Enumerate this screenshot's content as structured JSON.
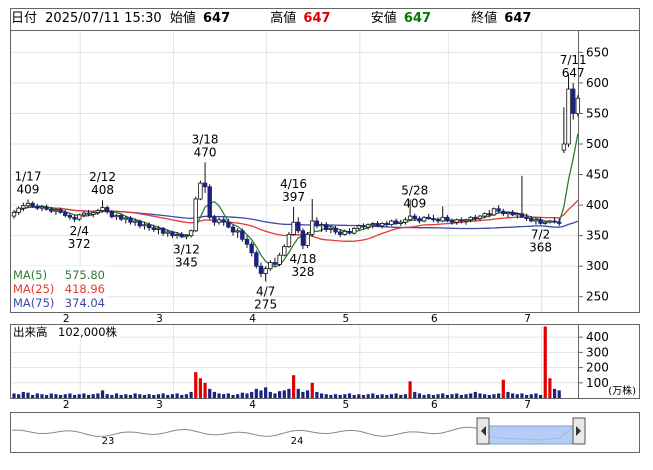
{
  "header": {
    "date_label": "日付",
    "date_value": "2025/07/11 15:30",
    "open_label": "始値",
    "open_value": "647",
    "high_label": "高値",
    "high_value": "647",
    "low_label": "安値",
    "low_value": "647",
    "close_label": "終値",
    "close_value": "647"
  },
  "colors": {
    "candle_up": "#ffffff",
    "candle_down": "#1a237e",
    "ma5": "#2e7d32",
    "ma25": "#e53935",
    "ma75": "#3949ab",
    "volume_normal": "#1a237e",
    "volume_high": "#e00000",
    "navigator_fill": "#a8c4f0"
  },
  "chart_data": [
    {
      "type": "candlestick",
      "ylim": [
        225,
        685
      ],
      "y_ticks": [
        250,
        300,
        350,
        400,
        450,
        500,
        550,
        600,
        650
      ],
      "x_tick_labels": [
        "2",
        "3",
        "4",
        "5",
        "6",
        "7"
      ],
      "x_tick_index": [
        14,
        34,
        54,
        74,
        93,
        113
      ],
      "moving_averages": [
        {
          "label": "MA(5)",
          "value": "575.80",
          "color": "#2e7d32"
        },
        {
          "label": "MA(25)",
          "value": "418.96",
          "color": "#e53935"
        },
        {
          "label": "MA(75)",
          "value": "374.04",
          "color": "#3949ab"
        }
      ],
      "annotations": [
        {
          "date": "1/17",
          "value": "409",
          "index": 3
        },
        {
          "date": "2/12",
          "value": "408",
          "index": 19
        },
        {
          "date": "2/4",
          "value": "372",
          "index": 14
        },
        {
          "date": "3/18",
          "value": "470",
          "index": 41
        },
        {
          "date": "3/12",
          "value": "345",
          "index": 37
        },
        {
          "date": "4/16",
          "value": "397",
          "index": 60
        },
        {
          "date": "4/18",
          "value": "328",
          "index": 62
        },
        {
          "date": "4/7",
          "value": "275",
          "index": 54
        },
        {
          "date": "5/28",
          "value": "409",
          "index": 86
        },
        {
          "date": "7/2",
          "value": "368",
          "index": 113
        },
        {
          "date": "7/11",
          "value": "647",
          "index": 120
        }
      ],
      "ohlc": [
        [
          382,
          392,
          378,
          388
        ],
        [
          388,
          398,
          384,
          395
        ],
        [
          395,
          404,
          390,
          399
        ],
        [
          399,
          409,
          395,
          403
        ],
        [
          403,
          406,
          396,
          398
        ],
        [
          398,
          402,
          392,
          395
        ],
        [
          395,
          400,
          390,
          397
        ],
        [
          397,
          401,
          391,
          393
        ],
        [
          393,
          397,
          387,
          390
        ],
        [
          390,
          394,
          384,
          392
        ],
        [
          392,
          396,
          386,
          388
        ],
        [
          388,
          392,
          380,
          383
        ],
        [
          383,
          387,
          376,
          380
        ],
        [
          380,
          384,
          372,
          377
        ],
        [
          377,
          386,
          374,
          384
        ],
        [
          384,
          390,
          380,
          387
        ],
        [
          387,
          392,
          382,
          385
        ],
        [
          385,
          390,
          380,
          388
        ],
        [
          388,
          394,
          384,
          391
        ],
        [
          391,
          408,
          388,
          396
        ],
        [
          396,
          399,
          386,
          389
        ],
        [
          389,
          392,
          378,
          381
        ],
        [
          381,
          386,
          376,
          383
        ],
        [
          383,
          386,
          374,
          377
        ],
        [
          377,
          382,
          370,
          379
        ],
        [
          379,
          382,
          368,
          372
        ],
        [
          372,
          378,
          366,
          374
        ],
        [
          374,
          376,
          362,
          366
        ],
        [
          366,
          372,
          360,
          368
        ],
        [
          368,
          372,
          358,
          363
        ],
        [
          363,
          368,
          356,
          360
        ],
        [
          360,
          366,
          352,
          362
        ],
        [
          362,
          364,
          350,
          354
        ],
        [
          354,
          360,
          348,
          356
        ],
        [
          356,
          358,
          346,
          350
        ],
        [
          350,
          356,
          345,
          352
        ],
        [
          352,
          356,
          346,
          348
        ],
        [
          348,
          352,
          344,
          350
        ],
        [
          350,
          360,
          347,
          358
        ],
        [
          358,
          414,
          356,
          410
        ],
        [
          410,
          440,
          408,
          436
        ],
        [
          436,
          470,
          420,
          430
        ],
        [
          430,
          434,
          376,
          380
        ],
        [
          380,
          384,
          366,
          372
        ],
        [
          372,
          380,
          368,
          376
        ],
        [
          376,
          380,
          366,
          372
        ],
        [
          372,
          378,
          362,
          364
        ],
        [
          364,
          368,
          350,
          356
        ],
        [
          356,
          362,
          346,
          358
        ],
        [
          358,
          362,
          340,
          344
        ],
        [
          344,
          350,
          330,
          336
        ],
        [
          336,
          340,
          316,
          322
        ],
        [
          322,
          326,
          296,
          300
        ],
        [
          300,
          306,
          282,
          288
        ],
        [
          288,
          300,
          275,
          296
        ],
        [
          296,
          310,
          292,
          306
        ],
        [
          306,
          314,
          300,
          303
        ],
        [
          303,
          322,
          300,
          318
        ],
        [
          318,
          336,
          316,
          332
        ],
        [
          332,
          356,
          330,
          352
        ],
        [
          352,
          397,
          350,
          372
        ],
        [
          372,
          380,
          354,
          358
        ],
        [
          358,
          362,
          328,
          334
        ],
        [
          334,
          356,
          330,
          352
        ],
        [
          352,
          410,
          348,
          374
        ],
        [
          374,
          380,
          362,
          366
        ],
        [
          366,
          372,
          356,
          368
        ],
        [
          368,
          372,
          356,
          360
        ],
        [
          360,
          366,
          354,
          362
        ],
        [
          362,
          366,
          352,
          356
        ],
        [
          356,
          360,
          348,
          352
        ],
        [
          352,
          360,
          350,
          357
        ],
        [
          357,
          362,
          352,
          354
        ],
        [
          354,
          364,
          352,
          362
        ],
        [
          362,
          368,
          358,
          366
        ],
        [
          366,
          370,
          360,
          364
        ],
        [
          364,
          370,
          360,
          368
        ],
        [
          368,
          372,
          362,
          370
        ],
        [
          370,
          374,
          364,
          366
        ],
        [
          366,
          372,
          362,
          370
        ],
        [
          370,
          374,
          364,
          368
        ],
        [
          368,
          376,
          366,
          374
        ],
        [
          374,
          378,
          368,
          370
        ],
        [
          370,
          376,
          366,
          372
        ],
        [
          372,
          380,
          368,
          376
        ],
        [
          376,
          409,
          374,
          382
        ],
        [
          382,
          386,
          374,
          378
        ],
        [
          378,
          382,
          370,
          374
        ],
        [
          374,
          382,
          372,
          380
        ],
        [
          380,
          386,
          376,
          378
        ],
        [
          378,
          384,
          372,
          376
        ],
        [
          376,
          380,
          370,
          374
        ],
        [
          374,
          398,
          372,
          380
        ],
        [
          380,
          384,
          372,
          374
        ],
        [
          374,
          378,
          368,
          372
        ],
        [
          372,
          378,
          368,
          376
        ],
        [
          376,
          380,
          370,
          374
        ],
        [
          374,
          378,
          368,
          376
        ],
        [
          376,
          382,
          372,
          380
        ],
        [
          380,
          384,
          374,
          378
        ],
        [
          378,
          384,
          374,
          382
        ],
        [
          382,
          388,
          378,
          386
        ],
        [
          386,
          392,
          380,
          384
        ],
        [
          384,
          396,
          382,
          394
        ],
        [
          394,
          400,
          386,
          390
        ],
        [
          390,
          394,
          382,
          386
        ],
        [
          386,
          390,
          380,
          388
        ],
        [
          388,
          392,
          382,
          384
        ],
        [
          384,
          388,
          378,
          386
        ],
        [
          386,
          448,
          382,
          380
        ],
        [
          380,
          386,
          374,
          378
        ],
        [
          378,
          382,
          372,
          374
        ],
        [
          374,
          378,
          368,
          376
        ],
        [
          376,
          380,
          368,
          370
        ],
        [
          370,
          374,
          368,
          372
        ],
        [
          372,
          376,
          370,
          374
        ],
        [
          374,
          380,
          370,
          372
        ],
        [
          372,
          378,
          366,
          370
        ],
        [
          490,
          560,
          485,
          500
        ],
        [
          500,
          615,
          495,
          590
        ],
        [
          590,
          600,
          540,
          550
        ],
        [
          550,
          580,
          545,
          575
        ]
      ]
    },
    {
      "type": "bar",
      "title": "出来高",
      "value_label": "102,000株",
      "unit_label": "(万株)",
      "y_ticks": [
        100,
        200,
        300,
        400
      ],
      "ylim": [
        0,
        480
      ],
      "values": [
        30,
        25,
        40,
        35,
        20,
        30,
        25,
        20,
        30,
        25,
        20,
        25,
        30,
        20,
        25,
        30,
        20,
        25,
        30,
        50,
        25,
        20,
        30,
        20,
        25,
        20,
        30,
        25,
        20,
        25,
        20,
        25,
        30,
        20,
        25,
        30,
        20,
        25,
        40,
        170,
        130,
        100,
        60,
        40,
        30,
        25,
        30,
        20,
        25,
        35,
        30,
        40,
        60,
        50,
        70,
        40,
        30,
        45,
        50,
        60,
        150,
        60,
        40,
        50,
        100,
        40,
        30,
        25,
        20,
        25,
        20,
        25,
        30,
        20,
        25,
        20,
        25,
        30,
        20,
        25,
        20,
        25,
        30,
        20,
        25,
        110,
        40,
        30,
        20,
        25,
        20,
        25,
        30,
        20,
        25,
        30,
        20,
        25,
        30,
        40,
        30,
        25,
        20,
        25,
        30,
        120,
        40,
        30,
        25,
        30,
        20,
        25,
        30,
        20,
        470,
        130,
        60,
        50
      ]
    }
  ],
  "navigator": {
    "labels": [
      "23",
      "24"
    ]
  }
}
